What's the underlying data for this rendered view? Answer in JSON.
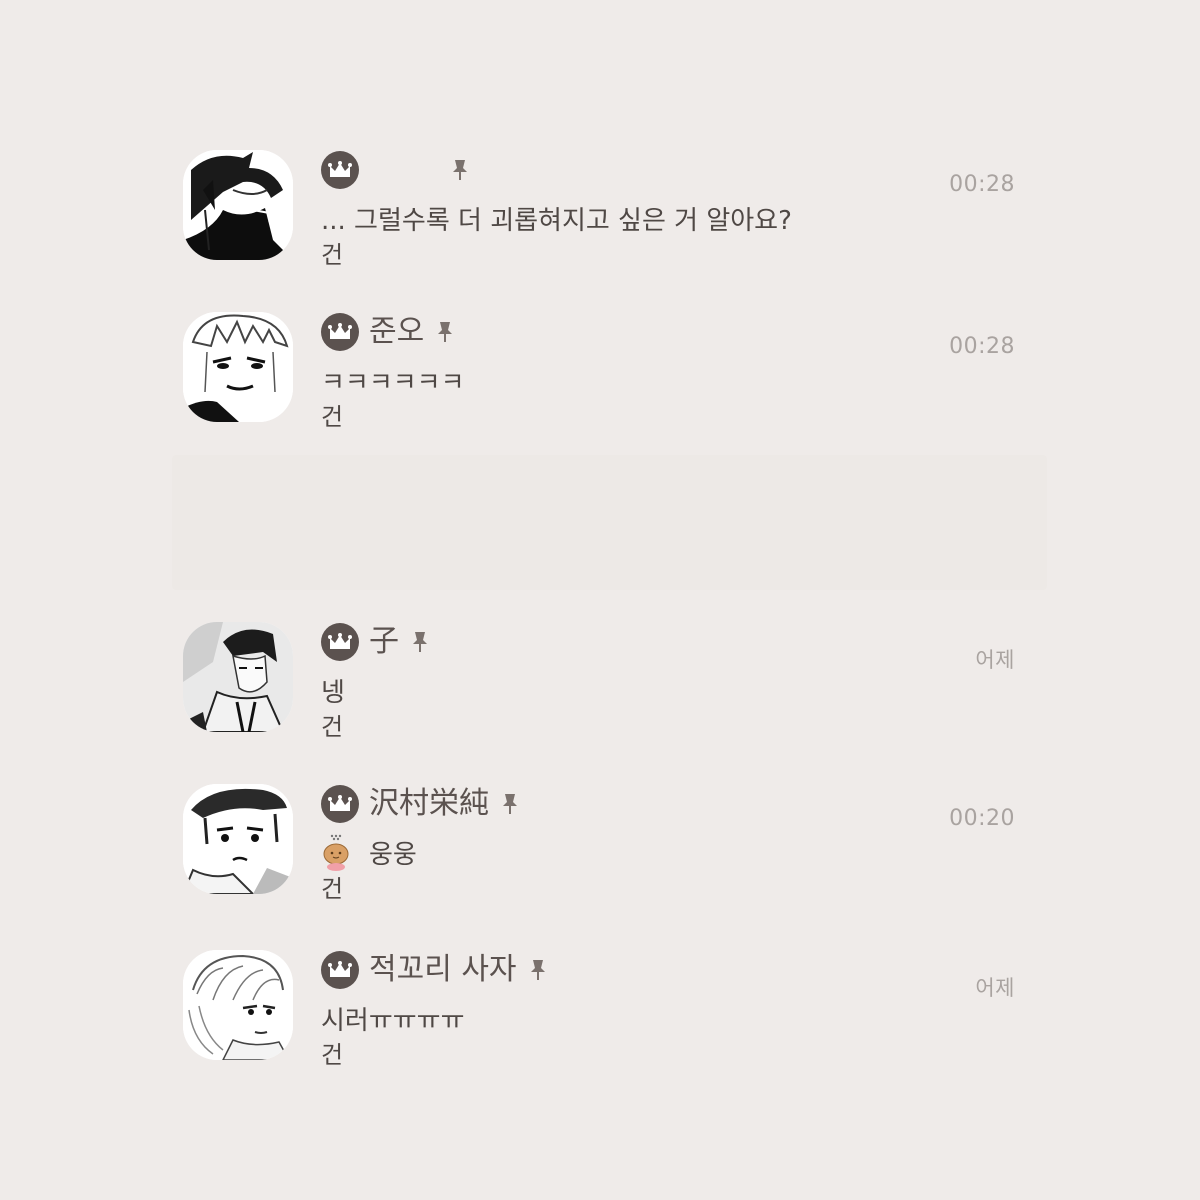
{
  "chats": [
    {
      "name": "",
      "message": "... 그럴수록 더 괴롭혀지고 싶은 거 알아요?",
      "sub": "건",
      "time": "00:28",
      "icon": "crown-icon",
      "pin_icon": "pin-icon"
    },
    {
      "name": "준오",
      "message": "ㅋㅋㅋㅋㅋㅋ",
      "sub": "건",
      "time": "00:28",
      "icon": "crown-icon",
      "pin_icon": "pin-icon"
    },
    {
      "name": "子",
      "message": "넹",
      "sub": "건",
      "time": "어제",
      "icon": "crown-icon",
      "pin_icon": "pin-icon"
    },
    {
      "name": "沢村栄純",
      "message": "웅웅",
      "sub": "건",
      "time": "00:20",
      "icon": "crown-icon",
      "pin_icon": "pin-icon",
      "sticker_icon": "potato-sticker-icon"
    },
    {
      "name": "적꼬리 사자",
      "message": "시러ㅠㅠㅠㅠ",
      "sub": "건",
      "time": "어제",
      "icon": "crown-icon",
      "pin_icon": "pin-icon"
    }
  ],
  "colors": {
    "background": "#efebe9",
    "badge": "#5b524f",
    "time": "#a9a3a0"
  }
}
